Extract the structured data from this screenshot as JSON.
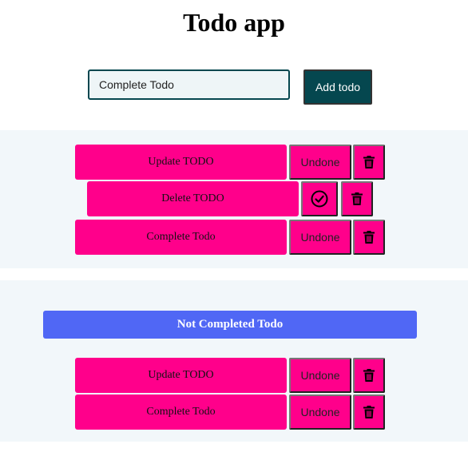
{
  "app": {
    "title": "Todo app"
  },
  "form": {
    "input_value": "Complete Todo",
    "add_label": "Add todo"
  },
  "todos": [
    {
      "text": "Update TODO",
      "status_label": "Undone",
      "completed": false
    },
    {
      "text": "Delete TODO",
      "status_label": "",
      "completed": true
    },
    {
      "text": "Complete Todo",
      "status_label": "Undone",
      "completed": false
    }
  ],
  "filter": {
    "label": "Not Completed Todo"
  },
  "filtered_todos": [
    {
      "text": "Update TODO",
      "status_label": "Undone"
    },
    {
      "text": "Complete Todo",
      "status_label": "Undone"
    }
  ],
  "icons": {
    "delete": "trash-icon",
    "done": "check-circle-icon"
  },
  "colors": {
    "item_bg": "#ff008b",
    "add_button": "#05474f",
    "filter_banner": "#5067f5",
    "section_bg": "#f2f7fa"
  }
}
